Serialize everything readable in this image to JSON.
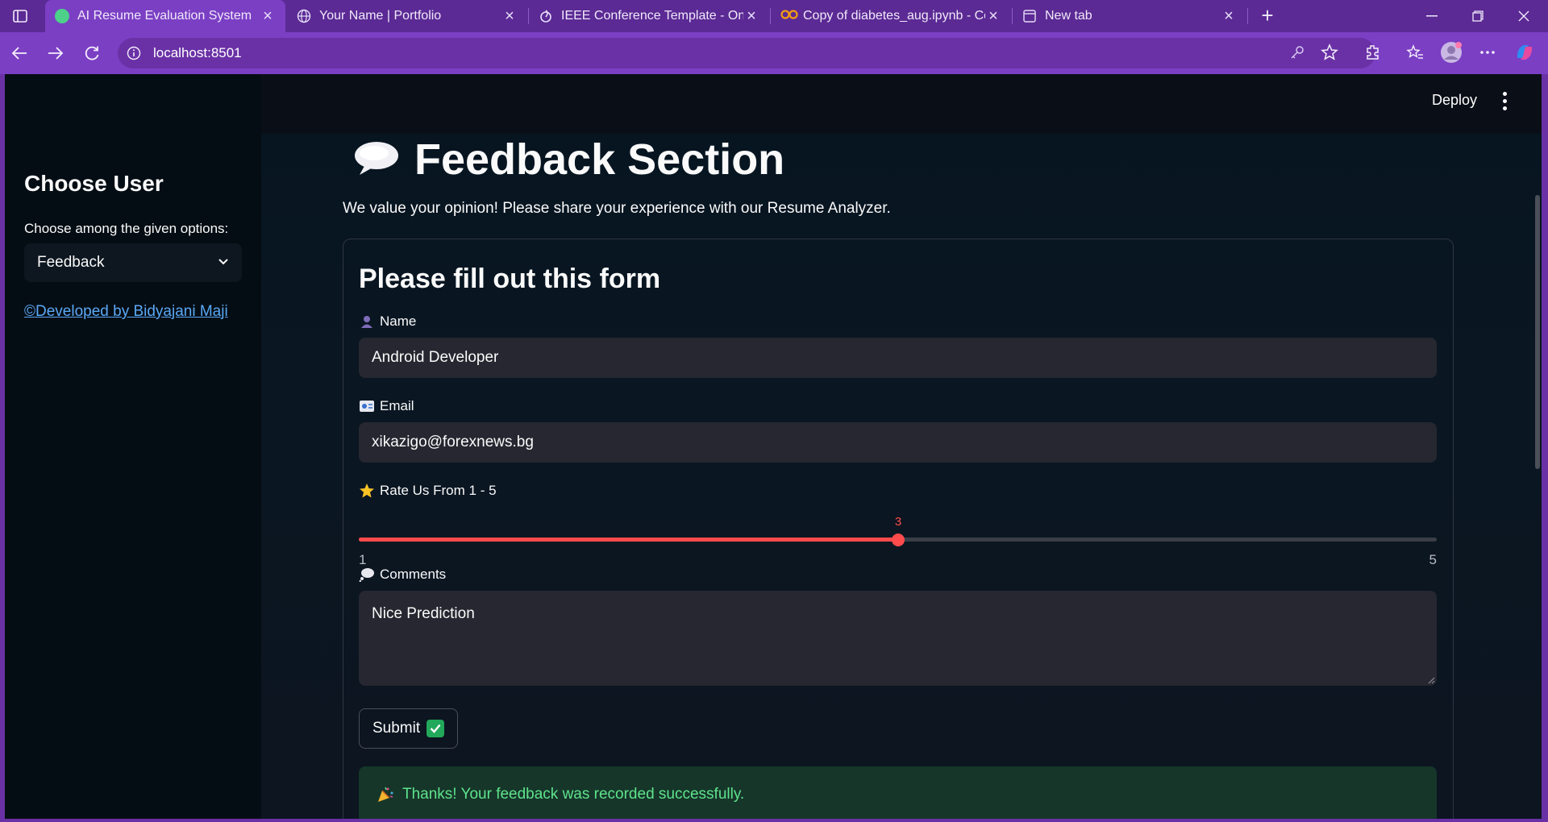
{
  "browser": {
    "tabs": [
      {
        "title": "AI Resume Evaluation System",
        "active": true,
        "favicon_color": "#4cd08a"
      },
      {
        "title": "Your Name | Portfolio",
        "active": false,
        "favicon": "globe-icon"
      },
      {
        "title": "IEEE Conference Template - Online",
        "active": false,
        "favicon": "overleaf-icon"
      },
      {
        "title": "Copy of diabetes_aug.ipynb - Colab",
        "active": false,
        "favicon": "colab-icon"
      },
      {
        "title": "New tab",
        "active": false,
        "favicon": "newtab-icon"
      }
    ],
    "url": "localhost:8501",
    "colors": {
      "frame": "#5b2a94",
      "toolbar": "#7b3fc4"
    }
  },
  "header": {
    "deploy_label": "Deploy"
  },
  "sidebar": {
    "title": "Choose User",
    "select_label": "Choose among the given options:",
    "select_value": "Feedback",
    "footer_link": "©Developed by Bidyajani Maji"
  },
  "main": {
    "title_emoji": "speech-balloon-icon",
    "title": "Feedback Section",
    "subtitle": "We value your opinion! Please share your experience with our Resume Analyzer.",
    "form": {
      "heading": "Please fill out this form",
      "name_label": "Name",
      "name_value": "Android Developer",
      "email_label": "Email",
      "email_value": "xikazigo@forexnews.bg",
      "rating_label": "Rate Us From 1 - 5",
      "rating_value": 3,
      "rating_min": 1,
      "rating_max": 5,
      "comments_label": "Comments",
      "comments_value": "Nice Prediction",
      "submit_label": "Submit"
    },
    "success_message": "Thanks! Your feedback was recorded successfully.",
    "colors": {
      "accent": "#ff4b4b",
      "success_text": "#5ee38b",
      "success_bg": "#16362a",
      "link": "#5aa8f5"
    }
  }
}
